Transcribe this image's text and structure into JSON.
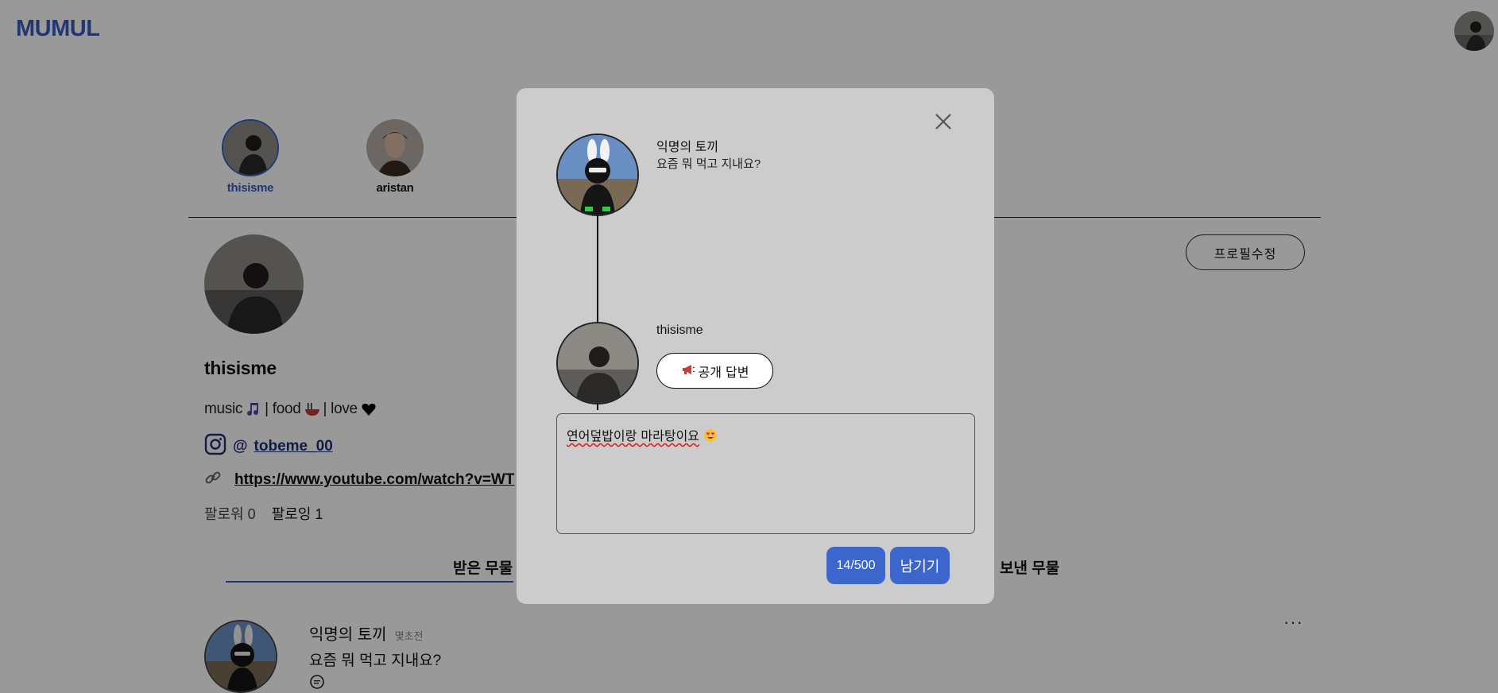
{
  "app": {
    "logo": "MUMUL"
  },
  "accounts": [
    {
      "name": "thisisme",
      "active": true
    },
    {
      "name": "aristan",
      "active": false
    }
  ],
  "profile": {
    "edit_label": "프로필수정",
    "name": "thisisme",
    "bio": {
      "music": "music",
      "food": "| food",
      "love": "| love",
      "sep": "|"
    },
    "instagram_at": "@",
    "instagram_handle": "tobeme_00",
    "link": "https://www.youtube.com/watch?v=WT",
    "followers": "팔로워 0",
    "following": "팔로잉 1"
  },
  "tabs": {
    "received": "받은 무물",
    "sent": "보낸 무물"
  },
  "feed": [
    {
      "author": "익명의 토끼",
      "time": "몇초전",
      "question": "요즘 뭐 먹고 지내요?",
      "more": "···"
    }
  ],
  "modal": {
    "question_author": "익명의 토끼",
    "question_text": "요즘 뭐 먹고 지내요?",
    "answer_author": "thisisme",
    "public_label": "공개 답변",
    "answer_text": "연어덮밥이랑  마라탕이요",
    "counter": "14/500",
    "submit_label": "남기기"
  },
  "colors": {
    "accent": "#3d66cc",
    "brand": "#3a5bbf"
  }
}
